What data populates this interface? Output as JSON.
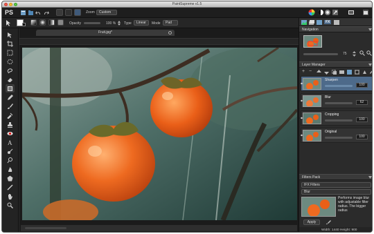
{
  "window": {
    "title": "PaintSupreme v1.5"
  },
  "menubar": {
    "app_label": "PS",
    "zoom_label": "Zoom",
    "zoom_value": "Custom"
  },
  "options": {
    "opacity_label": "Opacity",
    "opacity_value": "100 %",
    "type_label": "Type",
    "type_value": "Linear",
    "mode_label": "Mode",
    "mode_value": "Pad"
  },
  "document": {
    "tab_title": "Fruit.jpg*",
    "status_left": "",
    "size_label": "Width: 1440 Height: 900"
  },
  "panels": {
    "tabs": [
      "",
      "",
      "",
      "FX",
      ""
    ],
    "navigation": {
      "title": "Navigation",
      "zoom_value": "75"
    },
    "layers": {
      "title": "Layer Manager",
      "items": [
        {
          "name": "Sharpen",
          "value": "100",
          "selected": true
        },
        {
          "name": "Blur",
          "value": "62",
          "selected": false
        },
        {
          "name": "Cropping",
          "value": "100",
          "selected": false
        },
        {
          "name": "Original",
          "value": "100",
          "selected": false
        }
      ]
    },
    "filters": {
      "title": "Filters Pack",
      "category": "IFX Filters",
      "filter": "Blur",
      "description": "Performs image blur with adjustable filter radius. The bigger radius",
      "apply_label": "Apply"
    }
  },
  "colors": {
    "accent_selected": "#4d6a8a",
    "panel_bg": "#2b2b2b",
    "persimmon": "#e8651e"
  }
}
